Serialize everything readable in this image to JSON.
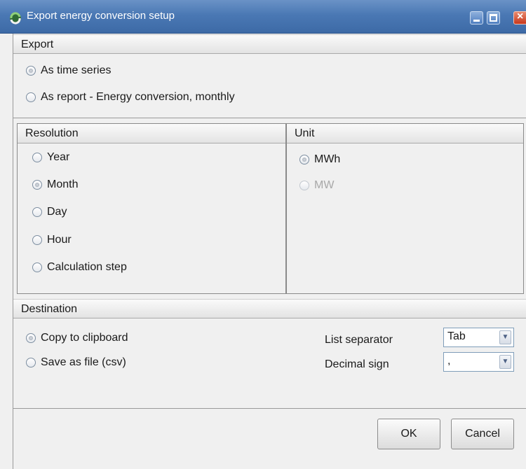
{
  "window": {
    "title": "Export energy conversion setup",
    "icon": "app-logo-icon"
  },
  "export_section": {
    "header": "Export",
    "options": [
      {
        "label": "As time series",
        "checked": true
      },
      {
        "label": "As report - Energy conversion, monthly",
        "checked": false
      }
    ]
  },
  "resolution_section": {
    "header": "Resolution",
    "options": [
      {
        "label": "Year",
        "checked": false
      },
      {
        "label": "Month",
        "checked": true
      },
      {
        "label": "Day",
        "checked": false
      },
      {
        "label": "Hour",
        "checked": false
      },
      {
        "label": "Calculation step",
        "checked": false
      }
    ]
  },
  "unit_section": {
    "header": "Unit",
    "options": [
      {
        "label": "MWh",
        "checked": true,
        "enabled": true
      },
      {
        "label": "MW",
        "checked": false,
        "enabled": false
      }
    ]
  },
  "destination_section": {
    "header": "Destination",
    "options": [
      {
        "label": "Copy to clipboard",
        "checked": true
      },
      {
        "label": "Save as file (csv)",
        "checked": false
      }
    ],
    "list_separator_label": "List separator",
    "list_separator_value": "Tab",
    "decimal_sign_label": "Decimal sign",
    "decimal_sign_value": ","
  },
  "buttons": {
    "ok": "OK",
    "cancel": "Cancel"
  }
}
